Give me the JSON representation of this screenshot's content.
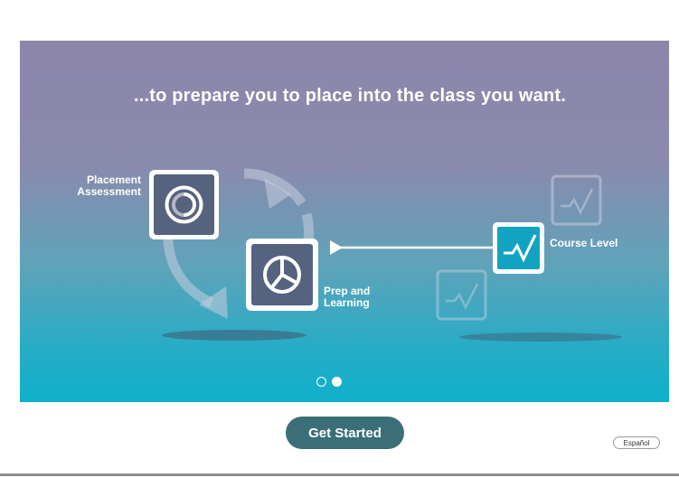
{
  "hero": {
    "headline": "...to prepare you to place into the class you want.",
    "labels": {
      "placement_line1": "Placement",
      "placement_line2": "Assessment",
      "prep_line1": "Prep and",
      "prep_line2": "Learning",
      "course_level": "Course Level"
    },
    "icons": {
      "placement": "assessment-target-icon",
      "prep": "pie-chart-icon",
      "course": "checkmark-graph-icon"
    },
    "carousel": {
      "slide_count": 2,
      "active_slide": 2
    }
  },
  "actions": {
    "get_started_label": "Get Started",
    "language_label": "Español"
  },
  "colors": {
    "primary_button": "#3b6f78",
    "course_box": "#13a3c2",
    "gradient_top": "#8d86ab",
    "gradient_bottom": "#0fb0cb"
  }
}
